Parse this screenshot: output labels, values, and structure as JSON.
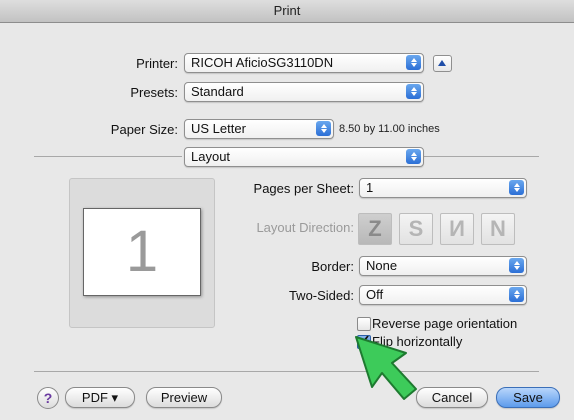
{
  "window": {
    "title": "Print"
  },
  "printer": {
    "label": "Printer:",
    "value": "RICOH AficioSG3110DN"
  },
  "presets": {
    "label": "Presets:",
    "value": "Standard"
  },
  "paper_size": {
    "label": "Paper Size:",
    "value": "US Letter",
    "dimensions": "8.50 by 11.00 inches"
  },
  "panel": {
    "value": "Layout"
  },
  "preview": {
    "page_number": "1"
  },
  "pages_per_sheet": {
    "label": "Pages per Sheet:",
    "value": "1"
  },
  "layout_direction": {
    "label": "Layout Direction:",
    "options": [
      "Z",
      "S",
      "И",
      "N"
    ]
  },
  "border": {
    "label": "Border:",
    "value": "None"
  },
  "two_sided": {
    "label": "Two-Sided:",
    "value": "Off"
  },
  "reverse_orientation": {
    "label": "Reverse page orientation",
    "checked": false
  },
  "flip_horizontally": {
    "label": "Flip horizontally",
    "checked": true
  },
  "footer": {
    "help": "?",
    "pdf": "PDF ▾",
    "preview": "Preview",
    "cancel": "Cancel",
    "save": "Save"
  }
}
